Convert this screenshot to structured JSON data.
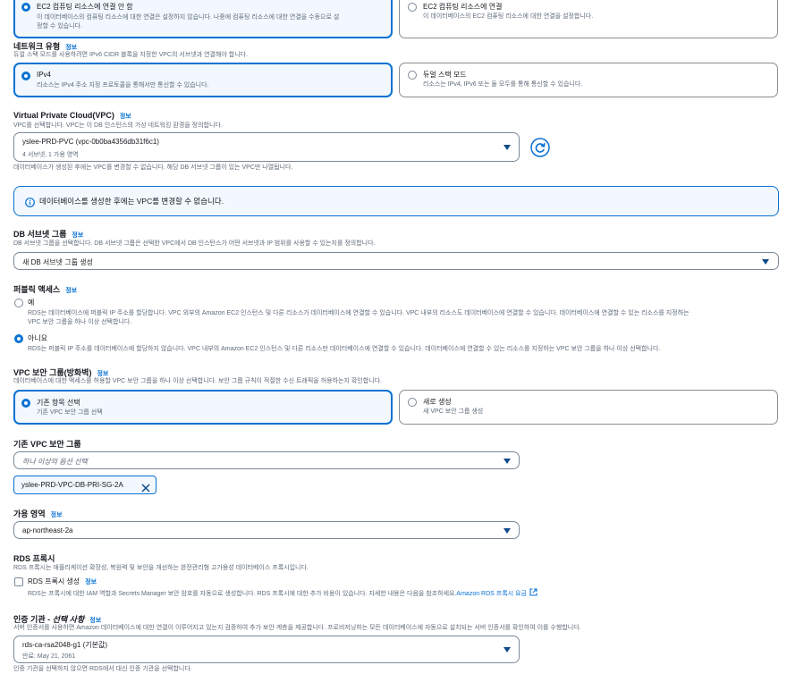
{
  "compute": {
    "option1_title": "EC2 컴퓨팅 리소스에 연결 안 함",
    "option1_desc_line1": "이 데이터베이스의 컴퓨팅 리소스에 대한 연결은 설정하지 않습니다. 나중에 컴퓨팅 리소스에 대한 연결을 수동으로 설",
    "option1_desc_line2": "정할 수 있습니다.",
    "option2_title": "EC2 컴퓨팅 리소스에 연결",
    "option2_desc": "이 데이터베이스의 EC2 컴퓨팅 리소스에 대한 연결을 설정합니다."
  },
  "network_type": {
    "label": "네트워크 유형",
    "info": "정보",
    "desc": "듀얼 스택 모드를 사용하려면 IPv6 CIDR 블록을 지정한 VPC의 서브넷과 연결해야 합니다.",
    "ipv4_title": "IPv4",
    "ipv4_desc": "리소스는 IPv4 주소 지정 프로토콜을 통해서만 통신할 수 있습니다.",
    "dual_title": "듀얼 스택 모드",
    "dual_desc": "리소스는 IPv4, IPv6 또는 둘 모두를 통해 통신할 수 있습니다."
  },
  "vpc": {
    "label": "Virtual Private Cloud(VPC)",
    "info": "정보",
    "desc": "VPC를 선택합니다. VPC는 이 DB 인스턴스의 가상 네트워킹 환경을 정의합니다.",
    "value": "yslee-PRD-PVC (vpc-0b0ba4356db31f6c1)",
    "sub": "4 서브넷, 1 가용 영역",
    "note": "데이터베이스가 생성된 후에는 VPC를 변경할 수 없습니다. 해당 DB 서브넷 그룹이 있는 VPC만 나열됩니다.",
    "alert": "데이터베이스를 생성한 후에는 VPC를 변경할 수 없습니다."
  },
  "subnet_group": {
    "label": "DB 서브넷 그룹",
    "info": "정보",
    "desc": "DB 서브넷 그룹을 선택합니다. DB 서브넷 그룹은 선택한 VPC에서 DB 인스턴스가 어떤 서브넷과 IP 범위를 사용할 수 있는지를 정의합니다.",
    "value": "새 DB 서브넷 그룹 생성"
  },
  "public_access": {
    "label": "퍼블릭 액세스",
    "info": "정보",
    "yes_title": "예",
    "yes_desc_line1": "RDS는 데이터베이스에 퍼블릭 IP 주소를 할당합니다. VPC 외부의 Amazon EC2 인스턴스 및 다른 리소스가 데이터베이스에 연결할 수 있습니다. VPC 내부의 리소스도 데이터베이스에 연결할 수 있습니다. 데이터베이스에 연결할 수 있는 리소스를 지정하는",
    "yes_desc_line2": "VPC 보안 그룹을 하나 이상 선택합니다.",
    "no_title": "아니요",
    "no_desc": "RDS는 퍼블릭 IP 주소를 데이터베이스에 할당하지 않습니다. VPC 내부의 Amazon EC2 인스턴스 및 다른 리소스만 데이터베이스에 연결할 수 있습니다. 데이터베이스에 연결할 수 있는 리소스를 지정하는 VPC 보안 그룹을 하나 이상 선택합니다."
  },
  "security_group": {
    "label": "VPC 보안 그룹(방화벽)",
    "info": "정보",
    "desc": "데이터베이스에 대한 액세스를 허용할 VPC 보안 그룹을 하나 이상 선택합니다. 보안 그룹 규칙이 적절한 수신 트래픽을 허용하는지 확인합니다.",
    "existing_title": "기존 항목 선택",
    "existing_desc": "기존 VPC 보안 그룹 선택",
    "new_title": "새로 생성",
    "new_desc": "새 VPC 보안 그룹 생성"
  },
  "existing_sg": {
    "label": "기존 VPC 보안 그룹",
    "placeholder": "하나 이상의 옵션 선택",
    "token": "yslee-PRD-VPC-DB-PRI-SG-2A"
  },
  "az": {
    "label": "가용 영역",
    "info": "정보",
    "value": "ap-northeast-2a"
  },
  "proxy": {
    "label": "RDS 프록시",
    "desc": "RDS 프록시는 애플리케이션 확장성, 복원력 및 보안을 개선하는 완전관리형 고가용성 데이터베이스 프록시입니다.",
    "checkbox_label": "RDS 프록시 생성",
    "info": "정보",
    "checkbox_desc": "RDS는 프록시에 대한 IAM 역할과 Secrets Manager 보안 암호를 자동으로 생성합니다. RDS 프록시에 대한 추가 비용이 있습니다. 자세한 내용은 다음을 참조하세요.",
    "link": "Amazon RDS 프록시 요금"
  },
  "cert": {
    "label_main": "인증 기관 - ",
    "label_em": "선택 사항",
    "info": "정보",
    "desc": "서버 인증서를 사용하면 Amazon 데이터베이스에 대한 연결이 이루어지고 있는지 검증하여 추가 보안 계층을 제공합니다. 프로비저닝하는 모든 데이터베이스에 자동으로 설치되는 서버 인증서를 확인하여 이를 수행합니다.",
    "value": "rds-ca-rsa2048-g1 (기본값)",
    "sub": "만료: May 21, 2061",
    "note": "인증 기관을 선택하지 않으면 RDS에서 대신 인증 기관을 선택합니다."
  },
  "colors": {
    "accent": "#0972d3",
    "alert_bg": "#f2f8fd",
    "link": "#0972d3",
    "caret": "#0f4a8a"
  }
}
